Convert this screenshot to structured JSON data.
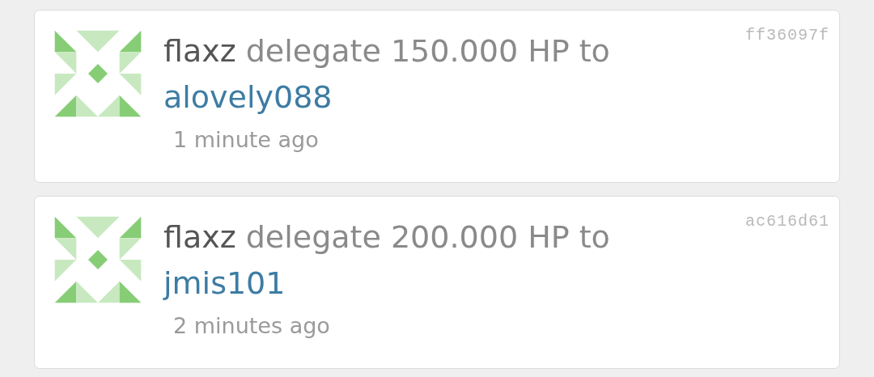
{
  "feed": [
    {
      "user": "flaxz",
      "action": "delegate 150.000 HP to",
      "target": "alovely088",
      "time": "1 minute ago",
      "hash": "ff36097f"
    },
    {
      "user": "flaxz",
      "action": "delegate 200.000 HP to",
      "target": "jmis101",
      "time": "2 minutes ago",
      "hash": "ac616d61"
    }
  ]
}
